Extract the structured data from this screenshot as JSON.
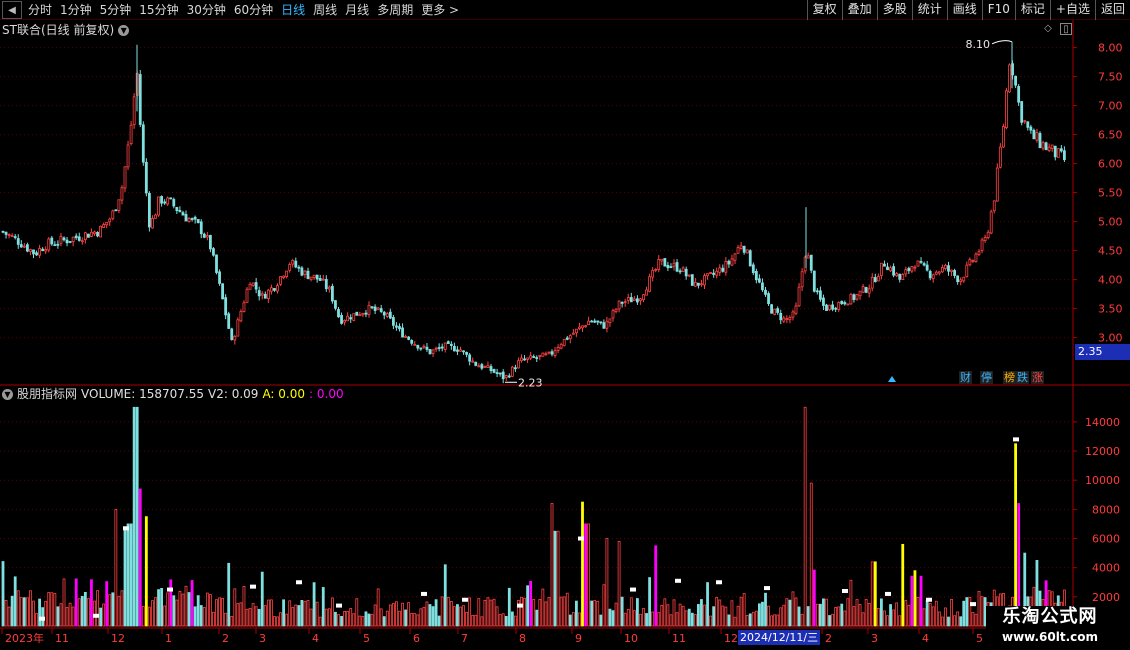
{
  "toolbar": {
    "back_icon": "left-triangle-icon",
    "periods": [
      "分时",
      "1分钟",
      "5分钟",
      "15分钟",
      "30分钟",
      "60分钟",
      "日线",
      "周线",
      "月线",
      "多周期"
    ],
    "active_period": "日线",
    "more_label": "更多 >",
    "right_buttons": [
      "复权",
      "叠加",
      "多股",
      "统计",
      "画线",
      "F10",
      "标记",
      "+自选",
      "返回"
    ]
  },
  "main_panel": {
    "title": "ST联合(日线 前复权)",
    "high_label": "8.10",
    "low_label": "2.23",
    "current_price": "2.35",
    "badges": [
      {
        "text": "财",
        "color": "#37b7ff"
      },
      {
        "text": "停",
        "color": "#37b7ff"
      },
      {
        "text": "榜",
        "color": "#ffb400"
      },
      {
        "text": "跌",
        "color": "#37b7ff"
      },
      {
        "text": "涨",
        "color": "#ff4444"
      }
    ]
  },
  "volume_panel": {
    "title": "股朋指标网",
    "volume_label": "VOLUME: 158707.55",
    "v2_label": "V2: 0.09",
    "a_label": "A: 0.00",
    "extra_label": ": 0.00"
  },
  "colors": {
    "up": "#ff4242",
    "down": "#7fe0e0",
    "grid": "#5a0000",
    "axis_text": "#ff3c3c",
    "highlight_yellow": "#ffff00",
    "highlight_magenta": "#ff00ff"
  },
  "x_axis": {
    "labels": [
      "2023年",
      "11",
      "12",
      "1",
      "2",
      "3",
      "4",
      "5",
      "6",
      "7",
      "8",
      "9",
      "10",
      "11",
      "12",
      "2",
      "3",
      "4",
      "5"
    ],
    "selected_date": "2024/12/11/三"
  },
  "chart_data": [
    {
      "type": "candlestick",
      "title": "ST联合(日线 前复权)",
      "y_ticks": [
        8.0,
        7.5,
        7.0,
        6.5,
        6.0,
        5.5,
        5.0,
        4.5,
        4.0,
        3.5,
        3.0
      ],
      "ylim": [
        2.2,
        8.2
      ],
      "max_marker": 8.1,
      "min_marker": 2.23,
      "last": 2.35,
      "path_points": [
        [
          0,
          4.85
        ],
        [
          20,
          4.65
        ],
        [
          35,
          4.45
        ],
        [
          45,
          4.6
        ],
        [
          70,
          4.7
        ],
        [
          100,
          4.85
        ],
        [
          112,
          5.1
        ],
        [
          122,
          5.6
        ],
        [
          130,
          6.5
        ],
        [
          137,
          7.6
        ],
        [
          142,
          6.2
        ],
        [
          150,
          4.9
        ],
        [
          160,
          5.4
        ],
        [
          172,
          5.3
        ],
        [
          185,
          5.1
        ],
        [
          200,
          4.9
        ],
        [
          210,
          4.6
        ],
        [
          222,
          3.7
        ],
        [
          232,
          2.9
        ],
        [
          240,
          3.4
        ],
        [
          250,
          4.0
        ],
        [
          262,
          3.7
        ],
        [
          275,
          3.9
        ],
        [
          290,
          4.3
        ],
        [
          305,
          4.1
        ],
        [
          320,
          4.0
        ],
        [
          330,
          3.8
        ],
        [
          340,
          3.3
        ],
        [
          355,
          3.4
        ],
        [
          370,
          3.5
        ],
        [
          385,
          3.4
        ],
        [
          400,
          3.1
        ],
        [
          415,
          2.9
        ],
        [
          430,
          2.75
        ],
        [
          445,
          2.85
        ],
        [
          460,
          2.8
        ],
        [
          475,
          2.55
        ],
        [
          490,
          2.45
        ],
        [
          505,
          2.3
        ],
        [
          520,
          2.6
        ],
        [
          535,
          2.65
        ],
        [
          550,
          2.7
        ],
        [
          560,
          2.9
        ],
        [
          575,
          3.1
        ],
        [
          590,
          3.3
        ],
        [
          605,
          3.2
        ],
        [
          620,
          3.6
        ],
        [
          640,
          3.7
        ],
        [
          660,
          4.3
        ],
        [
          680,
          4.2
        ],
        [
          695,
          3.9
        ],
        [
          715,
          4.1
        ],
        [
          730,
          4.3
        ],
        [
          742,
          4.65
        ],
        [
          755,
          4.1
        ],
        [
          770,
          3.5
        ],
        [
          785,
          3.3
        ],
        [
          795,
          3.4
        ],
        [
          806,
          4.55
        ],
        [
          815,
          3.8
        ],
        [
          825,
          3.5
        ],
        [
          840,
          3.6
        ],
        [
          855,
          3.7
        ],
        [
          870,
          3.9
        ],
        [
          885,
          4.3
        ],
        [
          900,
          4.0
        ],
        [
          915,
          4.3
        ],
        [
          930,
          4.1
        ],
        [
          945,
          4.2
        ],
        [
          960,
          4.0
        ],
        [
          975,
          4.4
        ],
        [
          986,
          4.7
        ],
        [
          995,
          5.5
        ],
        [
          1003,
          6.6
        ],
        [
          1010,
          7.9
        ],
        [
          1015,
          7.4
        ],
        [
          1020,
          6.9
        ],
        [
          1030,
          6.5
        ],
        [
          1045,
          6.3
        ],
        [
          1066,
          6.05
        ]
      ]
    },
    {
      "type": "bar",
      "title": "VOLUME",
      "y_ticks": [
        14000,
        12000,
        10000,
        8000,
        6000,
        4000,
        2000
      ],
      "ylim": [
        0,
        15500
      ],
      "spikes": [
        {
          "x": 115,
          "value": 8000
        },
        {
          "x": 124,
          "value": 6800
        },
        {
          "x": 130,
          "value": 7000
        },
        {
          "x": 136,
          "value": 15000
        },
        {
          "x": 140,
          "value": 9400
        },
        {
          "x": 146,
          "value": 7500
        },
        {
          "x": 229,
          "value": 4300
        },
        {
          "x": 446,
          "value": 4200
        },
        {
          "x": 551,
          "value": 8400
        },
        {
          "x": 557,
          "value": 6500
        },
        {
          "x": 583,
          "value": 8500
        },
        {
          "x": 587,
          "value": 7000
        },
        {
          "x": 606,
          "value": 6000
        },
        {
          "x": 620,
          "value": 5800
        },
        {
          "x": 656,
          "value": 5500
        },
        {
          "x": 806,
          "value": 15000
        },
        {
          "x": 812,
          "value": 9800
        },
        {
          "x": 874,
          "value": 4400
        },
        {
          "x": 902,
          "value": 5600
        },
        {
          "x": 1016,
          "value": 12500
        },
        {
          "x": 1019,
          "value": 8400
        },
        {
          "x": 1024,
          "value": 5000
        },
        {
          "x": 1036,
          "value": 4500
        }
      ],
      "markers": [
        {
          "x": 42,
          "value": 500
        },
        {
          "x": 96,
          "value": 700
        },
        {
          "x": 126,
          "value": 6700
        },
        {
          "x": 170,
          "value": 2500
        },
        {
          "x": 253,
          "value": 2700
        },
        {
          "x": 299,
          "value": 3000
        },
        {
          "x": 339,
          "value": 1400
        },
        {
          "x": 424,
          "value": 2200
        },
        {
          "x": 465,
          "value": 1800
        },
        {
          "x": 520,
          "value": 1400
        },
        {
          "x": 581,
          "value": 6000
        },
        {
          "x": 633,
          "value": 2500
        },
        {
          "x": 678,
          "value": 3100
        },
        {
          "x": 719,
          "value": 3000
        },
        {
          "x": 767,
          "value": 2600
        },
        {
          "x": 845,
          "value": 2400
        },
        {
          "x": 888,
          "value": 2200
        },
        {
          "x": 929,
          "value": 1800
        },
        {
          "x": 973,
          "value": 1500
        },
        {
          "x": 1016,
          "value": 12800
        }
      ]
    }
  ]
}
